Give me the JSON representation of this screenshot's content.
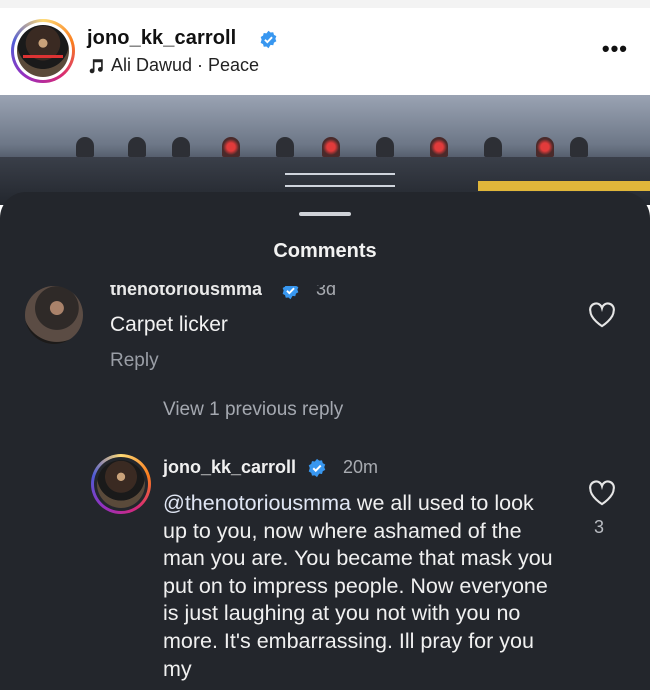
{
  "header": {
    "username": "jono_kk_carroll",
    "music": "Ali Dawud · Peace",
    "more_label": "•••"
  },
  "sheet": {
    "title": "Comments"
  },
  "comments": [
    {
      "username": "thenotoriousmma",
      "time": "3d",
      "text": "Carpet licker",
      "reply_label": "Reply"
    }
  ],
  "view_previous_label": "View 1 previous reply",
  "reply": {
    "username": "jono_kk_carroll",
    "time": "20m",
    "mention": "@thenotoriousmma",
    "text": " we all used to look up to you, now where ashamed of the man you are. You became that mask you put on to impress people. Now everyone is just laughing at you not with you no more. It's embarrassing. Ill pray for you my",
    "like_count": "3"
  },
  "colors": {
    "sheet_bg": "#23262c",
    "verified_blue": "#3897f0",
    "muted_text": "#9a9ea6"
  },
  "icons": [
    "verified-badge-icon",
    "music-note-icon",
    "more-options-icon",
    "heart-icon"
  ]
}
